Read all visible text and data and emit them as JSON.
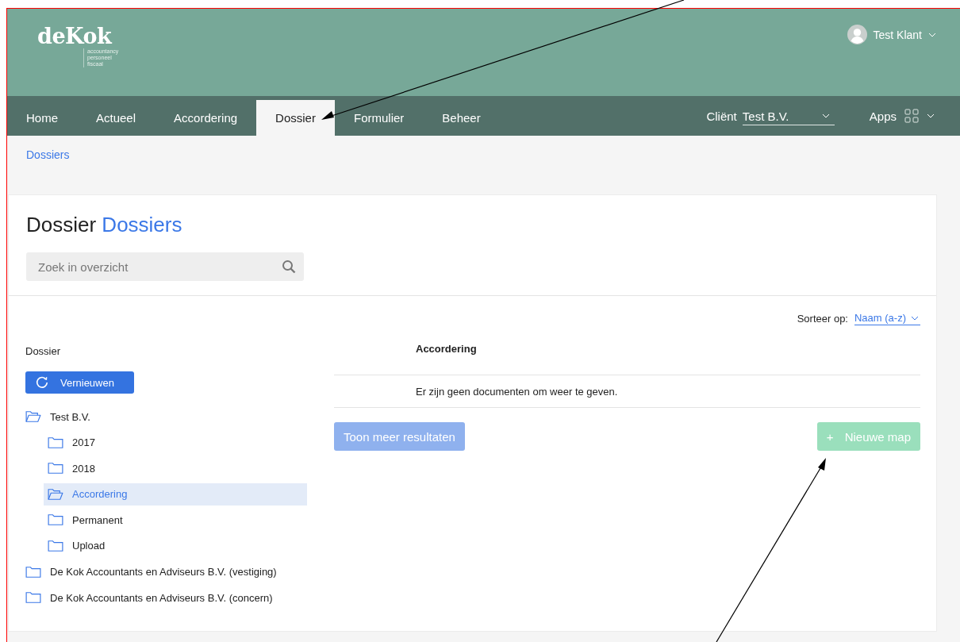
{
  "logo": {
    "name": "deKok",
    "tagline": [
      "accountancy",
      "personeel",
      "fiscaal"
    ]
  },
  "user": {
    "name": "Test Klant"
  },
  "nav": {
    "tabs": [
      {
        "label": "Home",
        "selected": false
      },
      {
        "label": "Actueel",
        "selected": false
      },
      {
        "label": "Accordering",
        "selected": false
      },
      {
        "label": "Dossier",
        "selected": true
      },
      {
        "label": "Formulier",
        "selected": false
      },
      {
        "label": "Beheer",
        "selected": false
      }
    ],
    "client_label": "Cliënt",
    "client_value": "Test B.V.",
    "apps_label": "Apps"
  },
  "breadcrumb": "Dossiers",
  "page_title": {
    "prefix": "Dossier",
    "highlight": "Dossiers"
  },
  "search": {
    "placeholder": "Zoek in overzicht"
  },
  "tree": {
    "heading": "Dossier",
    "refresh_button": "Vernieuwen",
    "items": [
      {
        "label": "Test B.V.",
        "expanded": true,
        "selected": false,
        "children": [
          {
            "label": "2017",
            "expanded": false,
            "selected": false
          },
          {
            "label": "2018",
            "expanded": false,
            "selected": false
          },
          {
            "label": "Accordering",
            "expanded": false,
            "selected": true
          },
          {
            "label": "Permanent",
            "expanded": false,
            "selected": false
          },
          {
            "label": "Upload",
            "expanded": false,
            "selected": false
          }
        ]
      },
      {
        "label": "De Kok Accountants en Adviseurs B.V. (vestiging)",
        "expanded": false,
        "selected": false
      },
      {
        "label": "De Kok Accountants en Adviseurs B.V. (concern)",
        "expanded": false,
        "selected": false
      }
    ]
  },
  "sort": {
    "label": "Sorteer op:",
    "value": "Naam (a-z)"
  },
  "table": {
    "column": "Accordering",
    "empty_message": "Er zijn geen documenten om weer te geven."
  },
  "buttons": {
    "more": {
      "label": "Toon meer resultaten",
      "disabled": true
    },
    "new_folder": {
      "icon": "+",
      "label": "Nieuwe map",
      "disabled": true
    }
  }
}
